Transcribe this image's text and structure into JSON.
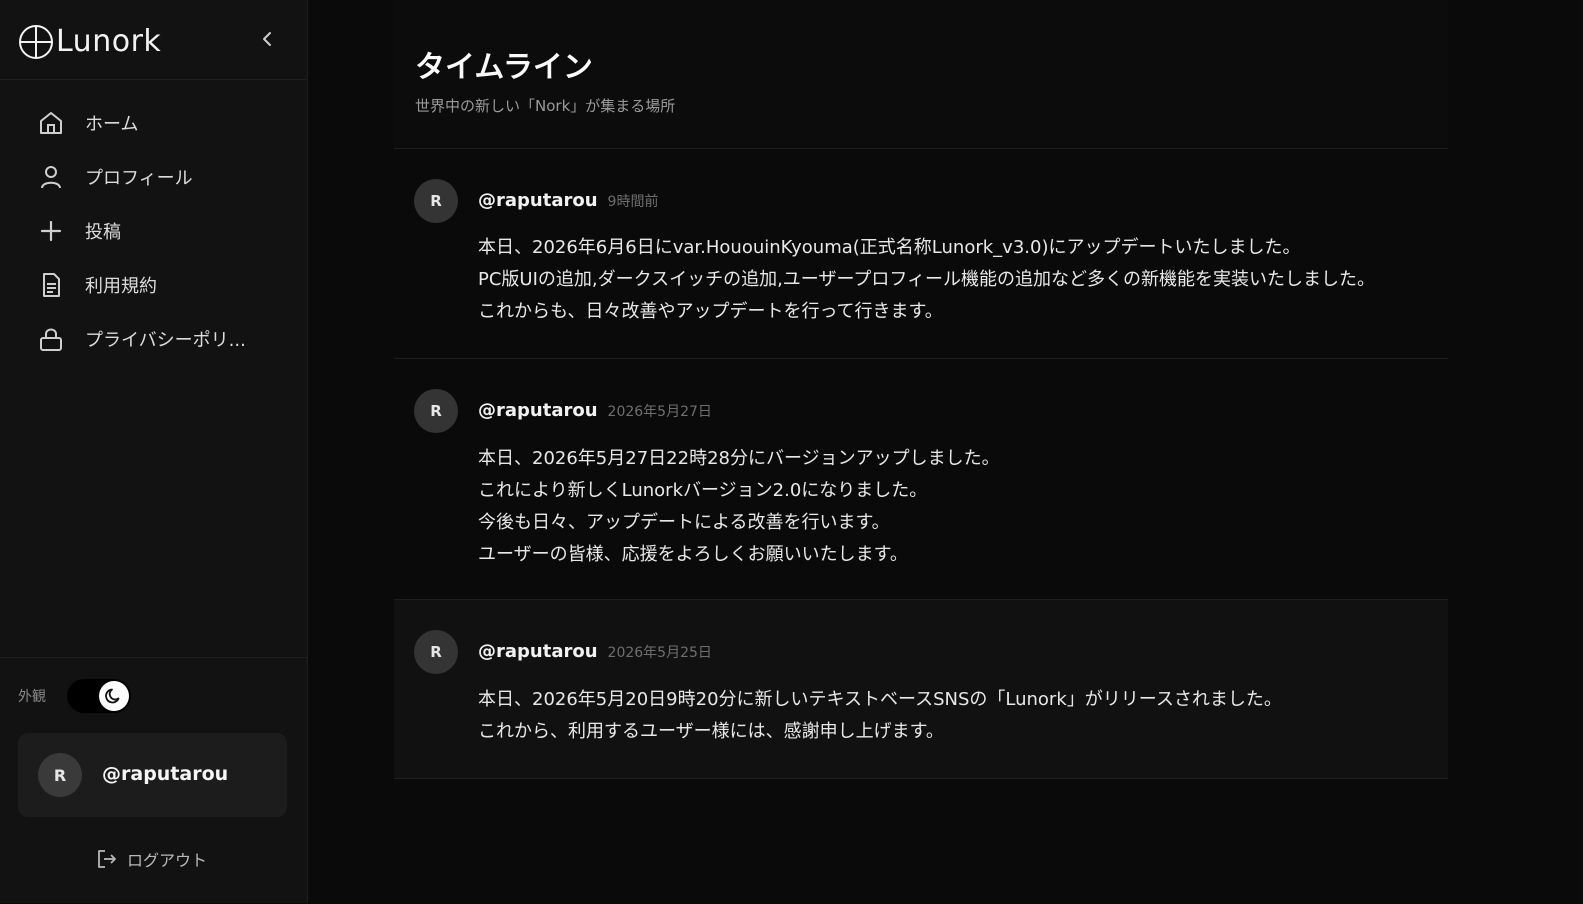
{
  "brand": {
    "name": "Lunork"
  },
  "nav": {
    "items": [
      {
        "label": "ホーム",
        "icon": "home-icon"
      },
      {
        "label": "プロフィール",
        "icon": "user-icon"
      },
      {
        "label": "投稿",
        "icon": "plus-icon"
      },
      {
        "label": "利用規約",
        "icon": "document-icon"
      },
      {
        "label": "プライバシーポリ...",
        "icon": "lock-icon"
      }
    ]
  },
  "appearance": {
    "label": "外観",
    "mode": "dark"
  },
  "user": {
    "avatar_initial": "R",
    "handle": "@raputarou"
  },
  "logout": {
    "label": "ログアウト"
  },
  "header": {
    "title": "タイムライン",
    "subtitle": "世界中の新しい「Nork」が集まる場所"
  },
  "posts": [
    {
      "avatar_initial": "R",
      "handle": "@raputarou",
      "time": "9時間前",
      "lines": [
        "本日、2026年6月6日にvar.HououinKyouma(正式名称Lunork_v3.0)にアップデートいたしました。",
        "PC版UIの追加,ダークスイッチの追加,ユーザープロフィール機能の追加など多くの新機能を実装いたしました。",
        "これからも、日々改善やアップデートを行って行きます。"
      ]
    },
    {
      "avatar_initial": "R",
      "handle": "@raputarou",
      "time": "2026年5月27日",
      "lines": [
        "本日、2026年5月27日22時28分にバージョンアップしました。",
        "これにより新しくLunorkバージョン2.0になりました。",
        "今後も日々、アップデートによる改善を行います。",
        "ユーザーの皆様、応援をよろしくお願いいたします。"
      ]
    },
    {
      "avatar_initial": "R",
      "handle": "@raputarou",
      "time": "2026年5月25日",
      "lines": [
        "本日、2026年5月20日9時20分に新しいテキストベースSNSの「Lunork」がリリースされました。",
        "これから、利用するユーザー様には、感謝申し上げます。"
      ]
    }
  ],
  "colors": {
    "background": "#0a0a0a",
    "sidebar": "#121212",
    "card": "#1c1c1c",
    "text": "#ededed"
  }
}
